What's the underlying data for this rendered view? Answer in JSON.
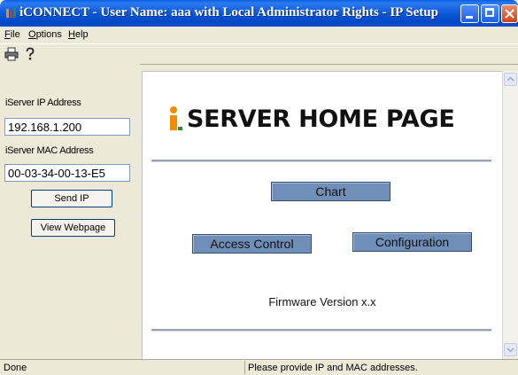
{
  "window": {
    "title": "iCONNECT - User Name:  aaa  with Local Administrator Rights - IP Setup",
    "brand_color": "#0a4ed0"
  },
  "menu": {
    "file": {
      "accel": "F",
      "rest": "ile"
    },
    "options": {
      "accel": "O",
      "rest": "ptions"
    },
    "help": {
      "accel": "H",
      "rest": "elp"
    }
  },
  "toolbar": {
    "icons": [
      "printer-icon",
      "help-icon"
    ]
  },
  "left_panel": {
    "ip_label": "iServer IP Address",
    "ip_value": "192.168.1.200",
    "mac_label": "iServer MAC Address",
    "mac_value": "00-03-34-00-13-E5",
    "send_ip_button": "Send IP",
    "view_webpage_button": "View Webpage"
  },
  "webpage": {
    "headline": "SERVER HOME PAGE",
    "chart_button": "Chart",
    "access_control_button": "Access Control",
    "configuration_button": "Configuration",
    "firmware": "Firmware Version x.x",
    "button_color": "#6f8fb8",
    "logo_colors": [
      "#f28c00",
      "#2e8b3a"
    ]
  },
  "status": {
    "left": "Done",
    "right": "Please provide IP and MAC addresses."
  }
}
